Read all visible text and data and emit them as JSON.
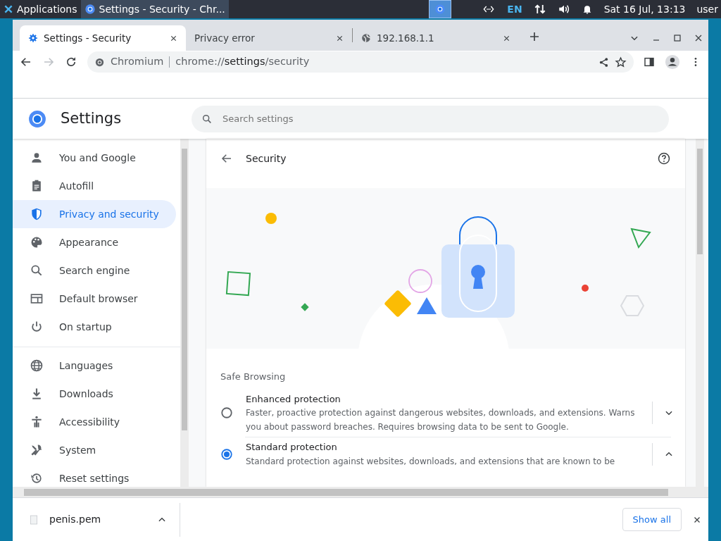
{
  "taskbar": {
    "apps_label": "Applications",
    "window_button": "Settings - Security - Chr...",
    "language": "EN",
    "clock": "Sat 16 Jul, 13:13",
    "user": "user"
  },
  "tabs": [
    {
      "title": "Settings - Security",
      "selected": true
    },
    {
      "title": "Privacy error",
      "selected": false
    },
    {
      "title": "192.168.1.1",
      "selected": false
    }
  ],
  "omnibox": {
    "site": "Chromium",
    "url_prefix": "chrome://",
    "url_host": "settings",
    "url_path": "/security"
  },
  "header": {
    "title": "Settings",
    "search_placeholder": "Search settings"
  },
  "sidebar": {
    "items": [
      {
        "label": "You and Google",
        "selected": false
      },
      {
        "label": "Autofill",
        "selected": false
      },
      {
        "label": "Privacy and security",
        "selected": true
      },
      {
        "label": "Appearance",
        "selected": false
      },
      {
        "label": "Search engine",
        "selected": false
      },
      {
        "label": "Default browser",
        "selected": false
      },
      {
        "label": "On startup",
        "selected": false
      }
    ],
    "advanced_items": [
      {
        "label": "Languages",
        "selected": false
      },
      {
        "label": "Downloads",
        "selected": false
      },
      {
        "label": "Accessibility",
        "selected": false
      },
      {
        "label": "System",
        "selected": false
      },
      {
        "label": "Reset settings",
        "selected": false
      }
    ]
  },
  "page": {
    "title": "Security",
    "section": "Safe Browsing",
    "options": [
      {
        "title": "Enhanced protection",
        "description": "Faster, proactive protection against dangerous websites, downloads, and extensions. Warns you about password breaches. Requires browsing data to be sent to Google.",
        "selected": false,
        "expanded": false
      },
      {
        "title": "Standard protection",
        "description": "Standard protection against websites, downloads, and extensions that are known to be",
        "selected": true,
        "expanded": true
      }
    ]
  },
  "download_bar": {
    "file": "penis.pem",
    "show_all": "Show all"
  }
}
